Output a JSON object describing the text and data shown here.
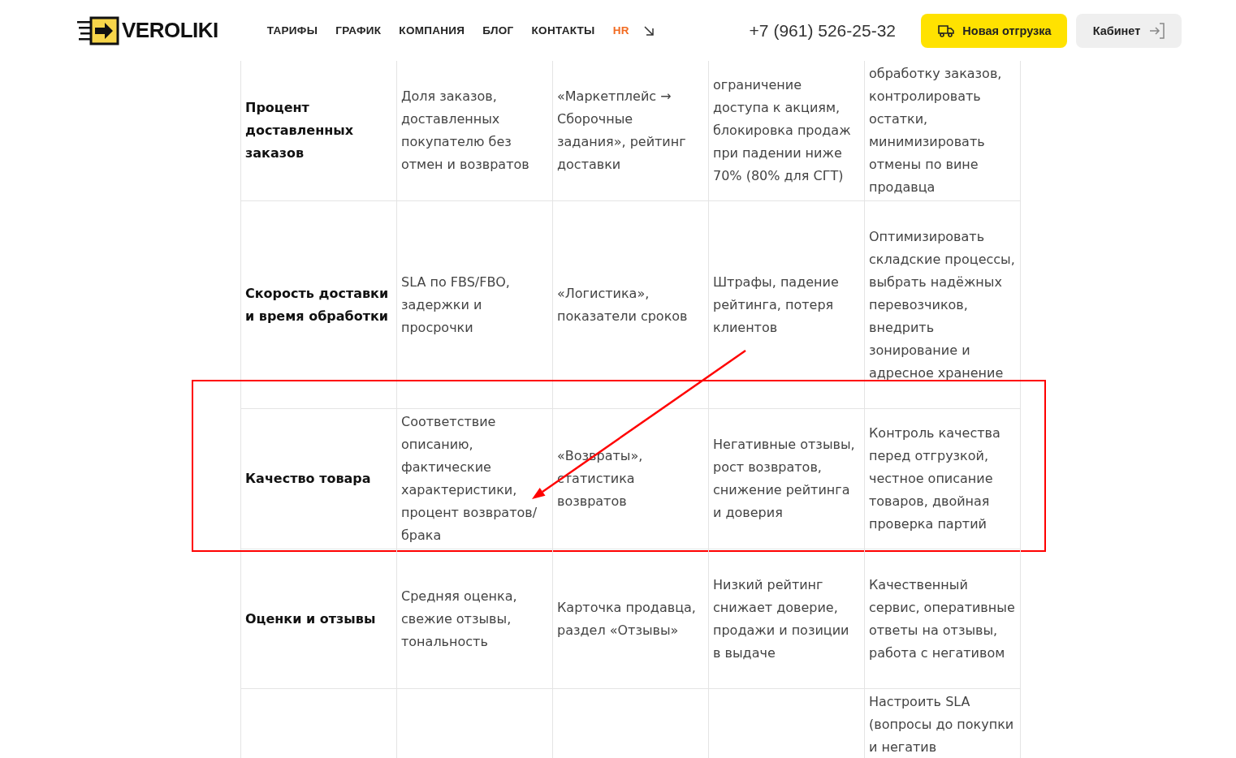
{
  "header": {
    "logo": "VEROLIKI",
    "nav": [
      {
        "label": "ТАРИФЫ",
        "kind": "link"
      },
      {
        "label": "ГРАФИК",
        "kind": "link"
      },
      {
        "label": "КОМПАНИЯ",
        "kind": "link"
      },
      {
        "label": "БЛОГ",
        "kind": "link"
      },
      {
        "label": "КОНТАКТЫ",
        "kind": "link"
      },
      {
        "label": "HR",
        "kind": "accent"
      }
    ],
    "phone": "+7 (961) 526-25-32",
    "buttons": [
      {
        "label": "Новая отгрузка",
        "kind": "primary"
      },
      {
        "label": "Кабинет",
        "kind": "secondary"
      }
    ]
  },
  "table": {
    "rows": [
      {
        "metric": "Процент доставленных заказов",
        "cells": [
          "Доля заказов, доставленных покупателю без отмен и возвратов",
          "«Маркетплейс → Сборочные задания», рейтинг доставки",
          "ограничение доступа к акциям, блокировка продаж при падении ниже 70% (80% для СГТ)",
          "обработку заказов, контролировать остатки, минимизировать отмены по вине продавца"
        ],
        "highlighted": false
      },
      {
        "metric": "Скорость доставки и время обработки",
        "cells": [
          "SLA по FBS/FBO, задержки и просрочки",
          "«Логистика», показатели сроков",
          "Штрафы, падение рейтинга, потеря клиентов",
          "Оптимизировать складские процессы, выбрать надёжных перевозчиков, внедрить зонирование и адресное хранение"
        ],
        "highlighted": false
      },
      {
        "metric": "Качество товара",
        "cells": [
          "Соответствие описанию, фактические характеристики, процент возвратов/брака",
          "«Возвраты», статистика возвратов",
          "Негативные отзывы, рост возвратов, снижение рейтинга и доверия",
          "Контроль качества перед отгрузкой, честное описание товаров, двойная проверка партий"
        ],
        "highlighted": true
      },
      {
        "metric": "Оценки и отзывы",
        "cells": [
          "Средняя оценка, свежие отзывы, тональность",
          "Карточка продавца, раздел «Отзывы»",
          "Низкий рейтинг снижает доверие, продажи и позиции в выдаче",
          "Качественный сервис, оперативные ответы на отзывы, работа с негативом"
        ],
        "highlighted": false
      },
      {
        "cells": [
          "",
          "",
          "",
          "Настроить SLA (вопросы до покупки и негатив"
        ],
        "highlighted": false
      }
    ]
  }
}
